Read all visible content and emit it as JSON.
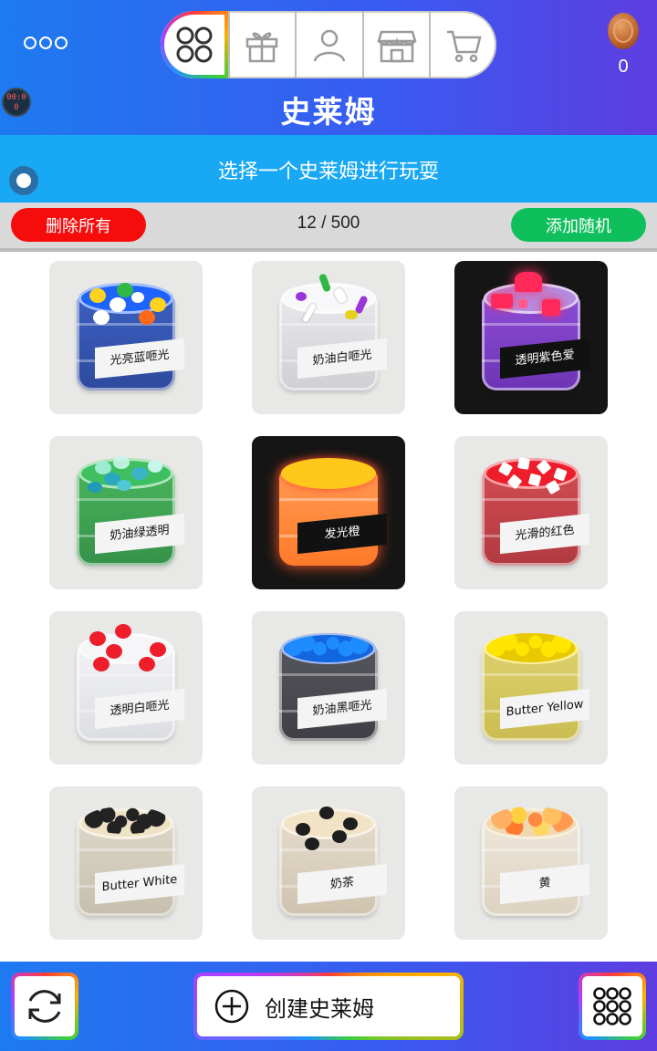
{
  "header": {
    "title": "史莱姆",
    "coin_count": "0",
    "clock_text": "00:0 0",
    "nav_tabs": [
      {
        "icon": "grid-icon",
        "active": true
      },
      {
        "icon": "gift-icon",
        "active": false
      },
      {
        "icon": "person-icon",
        "active": false
      },
      {
        "icon": "store-icon",
        "active": false
      },
      {
        "icon": "cart-icon",
        "active": false
      }
    ]
  },
  "subheader": {
    "text": "选择一个史莱姆进行玩耍"
  },
  "controls": {
    "delete_label": "删除所有",
    "count_text": "12 / 500",
    "random_label": "添加随机"
  },
  "slimes": [
    {
      "label": "光亮蓝咂光",
      "theme": "blue"
    },
    {
      "label": "奶油白咂光",
      "theme": "white"
    },
    {
      "label": "透明紫色爱",
      "theme": "purple"
    },
    {
      "label": "奶油绿透明",
      "theme": "green"
    },
    {
      "label": "发光橙",
      "theme": "orange"
    },
    {
      "label": "光滑的红色",
      "theme": "red"
    },
    {
      "label": "透明白咂光",
      "theme": "clear"
    },
    {
      "label": "奶油黑咂光",
      "theme": "black"
    },
    {
      "label": "Butter Yellow",
      "theme": "yellow"
    },
    {
      "label": "Butter White",
      "theme": "butterwhite"
    },
    {
      "label": "奶茶",
      "theme": "milktea"
    },
    {
      "label": "黄",
      "theme": "peach"
    }
  ],
  "bottom": {
    "create_label": "创建史莱姆"
  },
  "colors": {
    "header_blue": "#1e7af0",
    "subheader_blue": "#19a9f4",
    "delete_red": "#f70c0c",
    "random_green": "#0fbf5c"
  }
}
